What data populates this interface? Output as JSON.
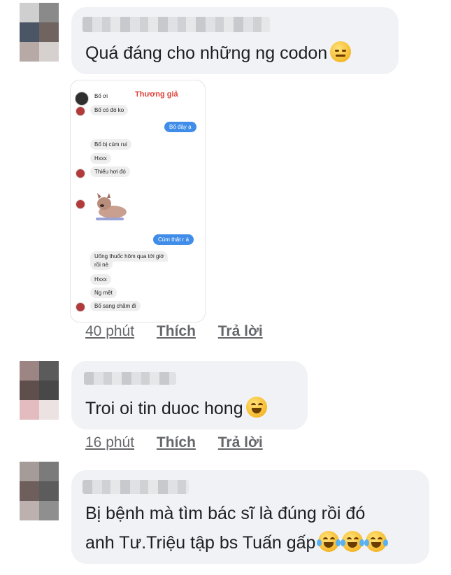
{
  "comments": [
    {
      "text": "Quá đáng cho những ng codon",
      "emoji": "expressionless-face-emoji",
      "time": "40 phút",
      "like": "Thích",
      "reply": "Trả lời",
      "attachment": {
        "title": "Thương giả",
        "messages": [
          {
            "dir": "in",
            "text": "Bố ơi"
          },
          {
            "dir": "in",
            "text": "Bố có đó ko"
          },
          {
            "dir": "out",
            "text": "Bố đây ạ"
          },
          {
            "dir": "in",
            "text": "Bố bị cúm rui"
          },
          {
            "dir": "in",
            "text": "Hxxx"
          },
          {
            "dir": "in",
            "text": "Thiếu hơi đó"
          },
          {
            "dir": "out",
            "text": "Cúm thật r á"
          },
          {
            "dir": "in",
            "text": "Uống thuốc hôm qua tới giờ"
          },
          {
            "dir": "in",
            "text": "rồi nè"
          },
          {
            "dir": "in",
            "text": "Hxxx"
          },
          {
            "dir": "in",
            "text": "Ng mệt"
          },
          {
            "dir": "in",
            "text": "Bố sang chăm đi"
          }
        ]
      }
    },
    {
      "text": "Troi oi tin duoc hong",
      "emoji": "grinning-squinting-face-emoji",
      "time": "16 phút",
      "like": "Thích",
      "reply": "Trả lời"
    },
    {
      "line1": "Bị bệnh mà tìm bác sĩ là đúng rồi đó",
      "line2": "anh Tư.Triệu tập bs Tuấn gấp",
      "emoji": "face-with-tears-of-joy-emoji",
      "time": "",
      "like": "",
      "reply": ""
    }
  ],
  "colors": {
    "bubble": "#f0f2f5",
    "text": "#1c1e21",
    "meta": "#65676b",
    "messenger_blue": "#3f8de8",
    "emoji_yellow": "#f5b92c"
  }
}
